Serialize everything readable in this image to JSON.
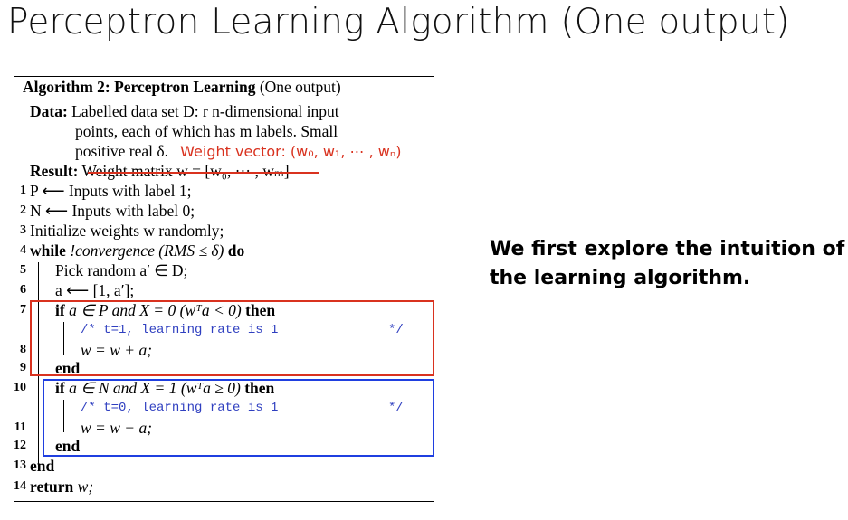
{
  "title": "Perceptron Learning Algorithm (One output)",
  "algorithm": {
    "caption_bold": "Algorithm 2: Perceptron Learning",
    "caption_rest": " (One output)",
    "data_label": "Data:",
    "data_line1": " Labelled data set D: r n-dimensional input",
    "data_line2": "points, each of which has m labels. Small",
    "data_line3": "positive real δ.",
    "weight_vector_note": "Weight vector: (w₀, w₁, ⋯ , wₙ)",
    "result_label": "Result:",
    "result_text": " Weight matrix w = [w₀,  ···  , wₘ]",
    "lines": [
      {
        "num": "1",
        "text": "P ⟵ Inputs with label 1;"
      },
      {
        "num": "2",
        "text": "N ⟵ Inputs with label 0;"
      },
      {
        "num": "3",
        "text": "Initialize weights w randomly;"
      },
      {
        "num": "4",
        "kw1": "while",
        "cond": " !convergence (RMS ≤ δ) ",
        "kw2": "do"
      },
      {
        "num": "5",
        "text": "Pick random a′ ∈ D;"
      },
      {
        "num": "6",
        "text": "a ⟵ [1, a′];"
      },
      {
        "num": "7",
        "kw1": "if",
        "cond": " a ∈ P and X = 0 (wᵀa < 0) ",
        "kw2": "then"
      },
      {
        "comment": "/* t=1, learning rate is 1",
        "comment_end": "*/"
      },
      {
        "num": "8",
        "text": "w = w + a;"
      },
      {
        "num": "9",
        "kw1": "end"
      },
      {
        "num": "10",
        "kw1": "if",
        "cond": " a ∈ N and X = 1 (wᵀa ≥ 0) ",
        "kw2": "then"
      },
      {
        "comment": "/* t=0, learning rate is 1",
        "comment_end": "*/"
      },
      {
        "num": "11",
        "text": "w = w − a;"
      },
      {
        "num": "12",
        "kw1": "end"
      },
      {
        "num": "13",
        "kw1": "end"
      },
      {
        "num": "14",
        "kw1": "return",
        "text": " w;"
      }
    ]
  },
  "intuition": "We first explore the intuition of the learning algorithm.",
  "colors": {
    "red": "#d9321f",
    "blue": "#1f3fe0"
  }
}
